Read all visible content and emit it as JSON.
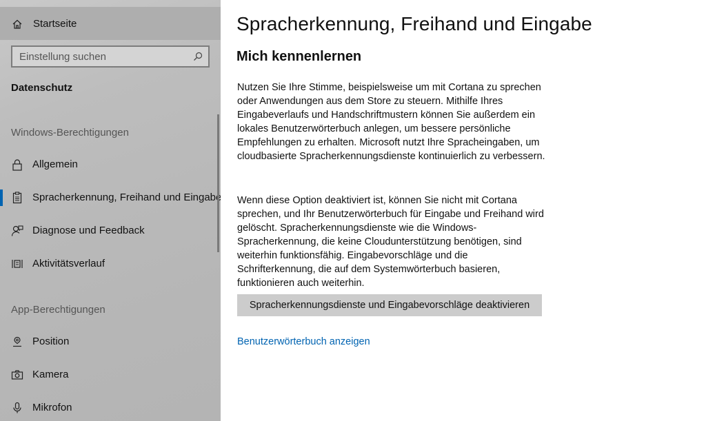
{
  "sidebar": {
    "home_label": "Startseite",
    "search_placeholder": "Einstellung suchen",
    "section_title": "Datenschutz",
    "group_windows": "Windows-Berechtigungen",
    "items_windows": [
      {
        "label": "Allgemein",
        "icon": "lock-icon"
      },
      {
        "label": "Spracherkennung, Freihand und Eingabe",
        "icon": "clipboard-icon",
        "selected": true
      },
      {
        "label": "Diagnose und Feedback",
        "icon": "diagnostics-icon"
      },
      {
        "label": "Aktivitätsverlauf",
        "icon": "activity-history-icon"
      }
    ],
    "group_apps": "App-Berechtigungen",
    "items_apps": [
      {
        "label": "Position",
        "icon": "location-icon"
      },
      {
        "label": "Kamera",
        "icon": "camera-icon"
      },
      {
        "label": "Mikrofon",
        "icon": "microphone-icon"
      }
    ]
  },
  "main": {
    "title": "Spracherkennung, Freihand und Eingabe",
    "subtitle": "Mich kennenlernen",
    "paragraph1": "Nutzen Sie Ihre Stimme, beispielsweise um mit Cortana zu sprechen oder Anwendungen aus dem Store zu steuern. Mithilfe Ihres Eingabeverlaufs und Handschriftmustern können Sie außerdem ein lokales Benutzerwörterbuch anlegen, um bessere persönliche Empfehlungen zu erhalten. Microsoft nutzt Ihre Spracheingaben, um cloudbasierte Spracherkennungsdienste kontinuierlich zu verbessern.",
    "paragraph2": "Wenn diese Option deaktiviert ist, können Sie nicht mit Cortana sprechen, und Ihr Benutzerwörterbuch für Eingabe und Freihand wird gelöscht. Spracherkennungsdienste wie die Windows-Spracherkennung, die keine Cloudunterstützung benötigen, sind weiterhin funktionsfähig. Eingabevorschläge und die Schrifterkennung, die auf dem Systemwörterbuch basieren, funktionieren auch weiterhin.",
    "button_label": "Spracherkennungsdienste und Eingabevorschläge deaktivieren",
    "link_label": "Benutzerwörterbuch anzeigen"
  },
  "colors": {
    "accent": "#0063b1",
    "sidebar_bg": "#bdbdbd",
    "home_bg": "#aeaeae",
    "button_bg": "#cccccc"
  }
}
